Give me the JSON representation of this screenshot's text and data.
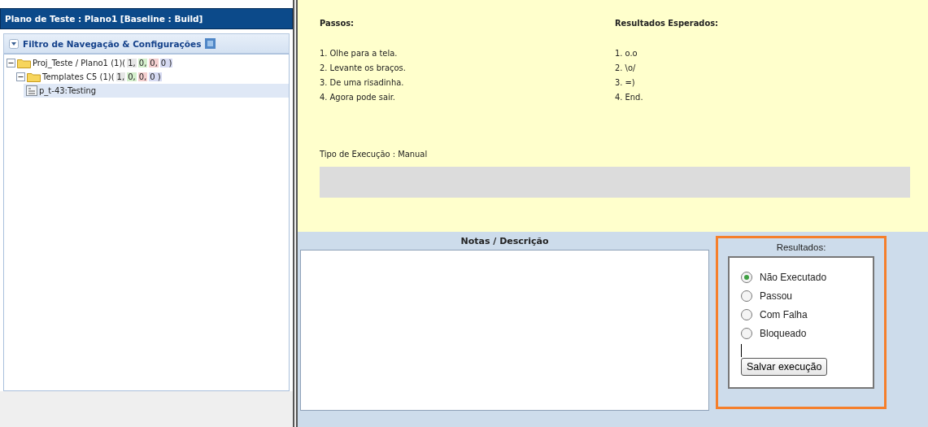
{
  "panel_title": "Plano de Teste : Plano1 [Baseline : Build]",
  "filter": {
    "label": "Filtro de Navegação & Configurações",
    "expanded": true
  },
  "tree": [
    {
      "kind": "folder",
      "label": "Proj_Teste / Plano1 (1)(",
      "counts": [
        {
          "text": "1,",
          "color": "#e6e6e6"
        },
        {
          "text": "0,",
          "color": "#d4efcc"
        },
        {
          "text": "0,",
          "color": "#f4cfcf"
        },
        {
          "text": "0 )",
          "color": "#d6daf2"
        }
      ],
      "expanded": true,
      "selected": false,
      "children": [
        {
          "kind": "folder",
          "label": "Templates C5 (1)(",
          "counts": [
            {
              "text": "1,",
              "color": "#e6e6e6"
            },
            {
              "text": "0,",
              "color": "#d4efcc"
            },
            {
              "text": "0,",
              "color": "#f4cfcf"
            },
            {
              "text": "0 )",
              "color": "#d6daf2"
            }
          ],
          "expanded": true,
          "selected": false,
          "children": [
            {
              "kind": "testcase",
              "label": "p_t-43:Testing",
              "selected": true
            }
          ]
        }
      ]
    }
  ],
  "steps": {
    "heading": "Passos:",
    "items": [
      "1. Olhe para a tela.",
      "2. Levante os braços.",
      "3. De uma risadinha.",
      "4. Agora pode sair."
    ]
  },
  "expected": {
    "heading": "Resultados Esperados:",
    "items": [
      "1. o.o",
      "2. \\o/",
      "3. =)",
      "4. End."
    ]
  },
  "execution_type": "Tipo de Execução : Manual",
  "notes": {
    "heading": "Notas / Descrição"
  },
  "results": {
    "heading": "Resultados:",
    "options": [
      {
        "label": "Não Executado",
        "selected": true
      },
      {
        "label": "Passou",
        "selected": false
      },
      {
        "label": "Com Falha",
        "selected": false
      },
      {
        "label": "Bloqueado",
        "selected": false
      }
    ],
    "button": "Salvar execução"
  }
}
